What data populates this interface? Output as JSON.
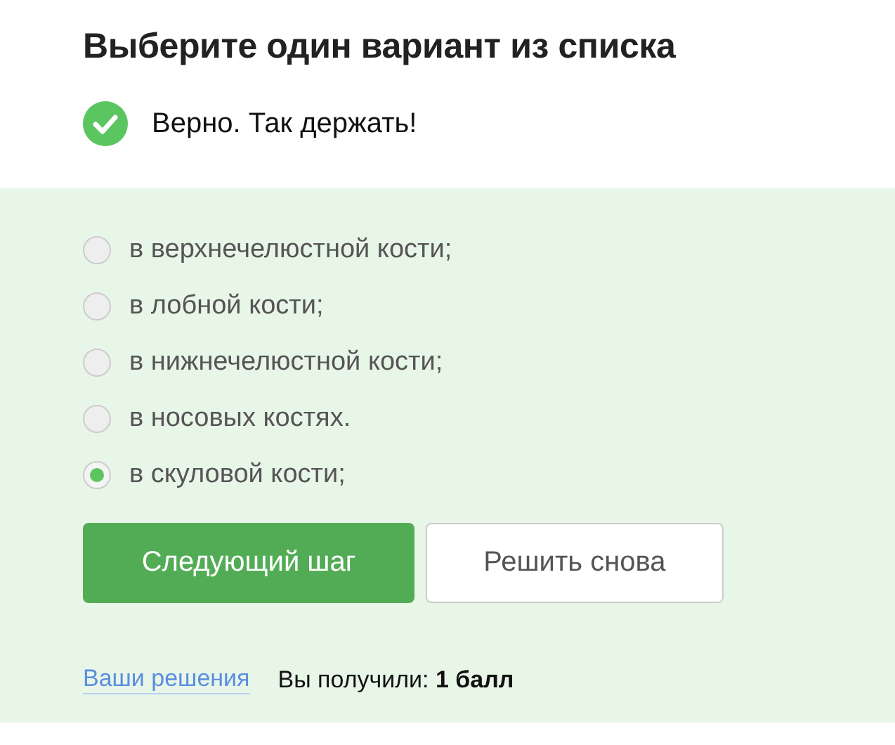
{
  "title": "Выберите один вариант из списка",
  "status": {
    "kind": "correct",
    "text": "Верно. Так держать!"
  },
  "options": [
    {
      "label": "в верхнечелюстной кости;",
      "selected": false
    },
    {
      "label": "в лобной кости;",
      "selected": false
    },
    {
      "label": "в нижнечелюстной кости;",
      "selected": false
    },
    {
      "label": "в носовых костях.",
      "selected": false
    },
    {
      "label": "в скуловой кости;",
      "selected": true
    }
  ],
  "buttons": [
    {
      "kind": "primary",
      "label": "Следующий шаг"
    },
    {
      "kind": "secondary",
      "label": "Решить снова"
    }
  ],
  "footer": {
    "link": "Ваши решения",
    "score": "Вы получили: **1 балл**"
  }
}
